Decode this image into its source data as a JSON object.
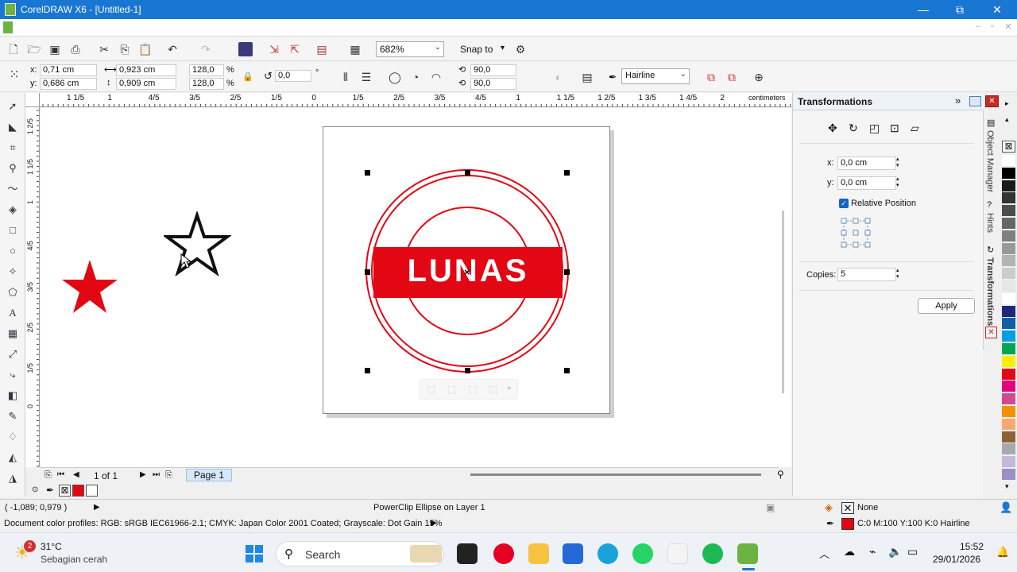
{
  "window": {
    "title": "CorelDRAW X6 - [Untitled-1]",
    "minimize": "—",
    "restore": "⧉",
    "close": "✕"
  },
  "menubar": {
    "min": "–",
    "restore": "▫",
    "close": "✕"
  },
  "toolbar": {
    "zoom_value": "682%",
    "snap_label": "Snap to"
  },
  "properties": {
    "x": "0,71 cm",
    "y": "0,686 cm",
    "x_label": "x:",
    "y_label": "y:",
    "width": "0,923 cm",
    "height": "0,909 cm",
    "scale_x": "128,0",
    "scale_y": "128,0",
    "percent": "%",
    "rotation": "0,0",
    "degree": "°",
    "angle_1": "90,0",
    "angle_2": "90,0",
    "outline_width": "Hairline"
  },
  "ruler": {
    "unit": "centimeters",
    "h_ticks": [
      "1 1/5",
      "1",
      "4/5",
      "3/5",
      "2/5",
      "1/5",
      "0",
      "1/5",
      "2/5",
      "3/5",
      "4/5",
      "1",
      "1 1/5",
      "1 2/5",
      "1 3/5",
      "1 4/5",
      "2"
    ],
    "v_ticks": [
      "1 2/5",
      "1 1/5",
      "1",
      "4/5",
      "3/5",
      "2/5",
      "1/5",
      "0"
    ]
  },
  "canvas": {
    "stamp_text": "LUNAS",
    "colors": {
      "red": "#e30613",
      "dark": "#111111"
    }
  },
  "pagebar": {
    "page_count": "1 of 1",
    "page_tab": "Page 1"
  },
  "status": {
    "cursor_pos": "( -1,089; 0,979 )",
    "selection_info": "PowerClip Ellipse on Layer 1",
    "fill_label": "None",
    "outline_info": "C:0 M:100 Y:100 K:0  Hairline",
    "color_profiles": "Document color profiles: RGB: sRGB IEC61966-2.1; CMYK: Japan Color 2001 Coated; Grayscale: Dot Gain 15%"
  },
  "docker": {
    "title": "Transformations",
    "x_label": "x:",
    "x_value": "0,0 cm",
    "y_label": "y:",
    "y_value": "0,0 cm",
    "relative_position": "Relative Position",
    "copies_label": "Copies:",
    "copies_value": "5",
    "apply_label": "Apply",
    "tabs": [
      "Object Manager",
      "Hints",
      "Transformations"
    ]
  },
  "palette": [
    "#ffffff",
    "#000000",
    "#1a1a1a",
    "#333333",
    "#4d4d4d",
    "#666666",
    "#808080",
    "#999999",
    "#b3b3b3",
    "#cccccc",
    "#e6e6e6",
    "#ffffff",
    "#1e2a78",
    "#0e5fa8",
    "#00a0e3",
    "#00a651",
    "#ffed00",
    "#e30613",
    "#e5007e",
    "#d04a8e",
    "#f39200",
    "#f7a973",
    "#8c6239",
    "#a7a9ac",
    "#c5b8da",
    "#9b8fc4"
  ],
  "taskbar": {
    "weather_temp": "31°C",
    "weather_desc": "Sebagian cerah",
    "weather_badge": "2",
    "search_placeholder": "Search",
    "time": "15:52",
    "date": "29/01/2026"
  }
}
